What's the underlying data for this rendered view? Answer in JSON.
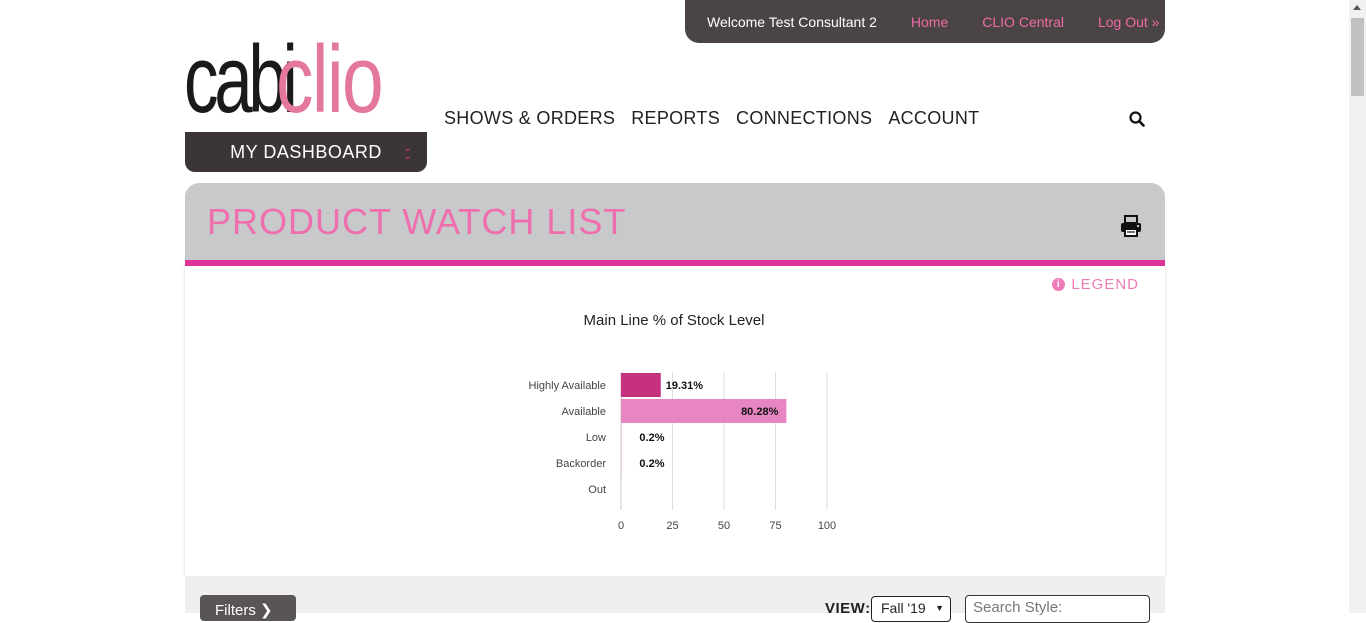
{
  "topbar": {
    "welcome": "Welcome Test Consultant 2",
    "links": [
      "Home",
      "CLIO Central",
      "Log Out »"
    ]
  },
  "logo": {
    "part1": "cabi",
    "part2": "clio"
  },
  "dashboard_button": "MY DASHBOARD",
  "nav": [
    "SHOWS & ORDERS",
    "REPORTS",
    "CONNECTIONS",
    "ACCOUNT"
  ],
  "panel": {
    "title": "PRODUCT WATCH LIST",
    "legend_label": "LEGEND"
  },
  "chart_data": {
    "type": "bar",
    "orientation": "horizontal",
    "title": "Main Line % of Stock Level",
    "categories": [
      "Highly Available",
      "Available",
      "Low",
      "Backorder",
      "Out"
    ],
    "values": [
      19.31,
      80.28,
      0.2,
      0.2,
      0
    ],
    "data_labels": [
      "19.31%",
      "80.28%",
      "0.2%",
      "0.2%",
      ""
    ],
    "colors": [
      "#c5317f",
      "#e786c3",
      "#e786c3",
      "#e786c3",
      "#e786c3"
    ],
    "xlim": [
      0,
      100
    ],
    "xticks": [
      0,
      25,
      50,
      75,
      100
    ],
    "grid": true
  },
  "filters": {
    "button_label": "Filters",
    "view_label": "VIEW:",
    "view_value": "Fall '19",
    "search_placeholder": "Search Style:"
  }
}
